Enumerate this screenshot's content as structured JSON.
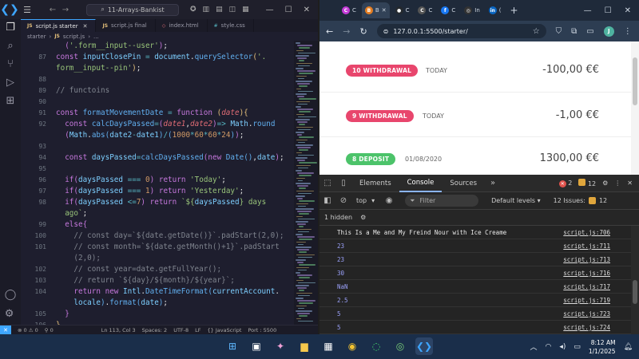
{
  "vscode": {
    "search_label": "11-Arrays-Bankist",
    "tabs": [
      {
        "label": "script.js starter",
        "type": "js",
        "active": true
      },
      {
        "label": "script.js final",
        "type": "js",
        "active": false
      },
      {
        "label": "index.html",
        "type": "html",
        "active": false
      },
      {
        "label": "style.css",
        "type": "css",
        "active": false
      }
    ],
    "breadcrumb": [
      "starter",
      "script.js",
      "..."
    ],
    "code_lines": [
      {
        "ln": "",
        "html": "  <span class='br2'>(</span><span class='str'>'.form__input--user'</span><span class='br2'>)</span>;"
      },
      {
        "ln": "87",
        "html": "<span class='kw'>const</span> <span class='var'>inputClosePin</span> <span class='op'>=</span> <span class='var'>document</span>.<span class='fn'>querySelector</span><span class='br1'>(</span><span class='str'>'.</span>"
      },
      {
        "ln": "",
        "html": "<span class='str'>form__input--pin'</span><span class='br1'>)</span>;"
      },
      {
        "ln": "88",
        "html": ""
      },
      {
        "ln": "89",
        "html": "<span class='cm'>// functoins</span>"
      },
      {
        "ln": "90",
        "html": ""
      },
      {
        "ln": "91",
        "html": "<span class='kw'>const</span> <span class='fn'>formatMovementDate</span> <span class='op'>=</span> <span class='kw'>function</span> <span class='br1'>(</span><span class='par'>date</span><span class='br1'>){</span>"
      },
      {
        "ln": "92",
        "html": "  <span class='kw'>const</span> <span class='fn'>calcDaysPassed</span><span class='op'>=</span><span class='br2'>(</span><span class='par'>date1</span>,<span class='par'>date2</span><span class='br2'>)</span><span class='op'>=></span> <span class='var'>Math</span>.<span class='fn'>round</span>"
      },
      {
        "ln": "",
        "html": "  <span class='br2'>(</span><span class='var'>Math</span>.<span class='fn'>abs</span><span class='fn'>(</span><span class='var'>date2</span><span class='op'>-</span><span class='var'>date1</span><span class='fn'>)</span><span class='op'>/</span><span class='fn'>(</span><span class='num'>1000</span><span class='op'>*</span><span class='num'>60</span><span class='op'>*</span><span class='num'>60</span><span class='op'>*</span><span class='num'>24</span><span class='fn'>)</span><span class='br2'>)</span>;"
      },
      {
        "ln": "93",
        "html": ""
      },
      {
        "ln": "94",
        "html": "  <span class='kw'>const</span> <span class='var'>daysPassed</span><span class='op'>=</span><span class='fn'>calcDaysPassed</span><span class='br2'>(</span><span class='kw'>new</span> <span class='fn'>Date</span><span class='fn'>()</span>,<span class='var'>date</span><span class='br2'>)</span>;"
      },
      {
        "ln": "95",
        "html": ""
      },
      {
        "ln": "96",
        "html": "  <span class='kw'>if</span><span class='br2'>(</span><span class='var'>daysPassed</span> <span class='op'>===</span> <span class='num'>0</span><span class='br2'>)</span> <span class='kw'>return</span> <span class='str'>'Today'</span>;"
      },
      {
        "ln": "97",
        "html": "  <span class='kw'>if</span><span class='br2'>(</span><span class='var'>daysPassed</span> <span class='op'>===</span> <span class='num'>1</span><span class='br2'>)</span> <span class='kw'>return</span> <span class='str'>'Yesterday'</span>;"
      },
      {
        "ln": "98",
        "html": "  <span class='kw'>if</span><span class='br2'>(</span><span class='var'>daysPassed</span> <span class='op'><=</span><span class='num'>7</span><span class='br2'>)</span> <span class='kw'>return</span> <span class='str'>`${</span><span class='var'>daysPassed</span><span class='str'>} days</span>"
      },
      {
        "ln": "",
        "html": "  <span class='str'>ago`</span>;"
      },
      {
        "ln": "99",
        "html": "  <span class='kw'>else</span><span class='br2'>{</span>"
      },
      {
        "ln": "100",
        "html": "    <span class='cm'>// const day=`${date.getDate()}`.padStart(2,0);</span>"
      },
      {
        "ln": "101",
        "html": "    <span class='cm'>// const month=`${date.getMonth()+1}`.padStart</span>"
      },
      {
        "ln": "",
        "html": "    <span class='cm'>(2,0);</span>"
      },
      {
        "ln": "102",
        "html": "    <span class='cm'>// const year=date.getFullYear();</span>"
      },
      {
        "ln": "103",
        "html": "    <span class='cm'>// return `${day}/${month}/${year}`;</span>"
      },
      {
        "ln": "104",
        "html": "    <span class='kw'>return</span> <span class='kw'>new</span> <span class='var'>Intl</span>.<span class='fn'>DateTimeFormat</span><span class='fn'>(</span><span class='var'>currentAccount</span>."
      },
      {
        "ln": "",
        "html": "    <span class='var'>locale</span><span class='fn'>)</span>.<span class='fn'>format</span><span class='fn'>(</span><span class='var'>date</span><span class='fn'>)</span>;"
      },
      {
        "ln": "105",
        "html": "  <span class='br2'>}</span>"
      },
      {
        "ln": "106",
        "html": "<span class='br1'>}</span>"
      }
    ],
    "status": {
      "errors": "0",
      "warnings": "0",
      "position": "Ln 113, Col 3",
      "spaces": "Spaces: 2",
      "encoding": "UTF-8",
      "eol": "LF",
      "language": "{} JavaScript",
      "port": "Port : 5500"
    }
  },
  "browser": {
    "tabs": [
      {
        "label": "C",
        "fav": "C",
        "color": "#c43ad6",
        "active": false
      },
      {
        "label": "B",
        "fav": "B",
        "color": "#e67e22",
        "active": true
      },
      {
        "label": "C",
        "fav": "●",
        "color": "#24292e",
        "active": false
      },
      {
        "label": "C",
        "fav": "C",
        "color": "#555",
        "active": false
      },
      {
        "label": "C",
        "fav": "f",
        "color": "#1877f2",
        "active": false
      },
      {
        "label": "In",
        "fav": "◎",
        "color": "#333",
        "active": false
      },
      {
        "label": "(",
        "fav": "in",
        "color": "#0a66c2",
        "active": false
      }
    ],
    "url": "127.0.0.1:5500/starter/",
    "avatar_letter": "J",
    "movements": [
      {
        "badge": "10 WITHDRAWAL",
        "type": "withdrawal",
        "date": "TODAY",
        "value": "-100,00 €€"
      },
      {
        "badge": "9 WITHDRAWAL",
        "type": "withdrawal",
        "date": "TODAY",
        "value": "-1,00 €€"
      },
      {
        "badge": "8 DEPOSIT",
        "type": "deposit",
        "date": "01/08/2020",
        "value": "1300,00 €€"
      }
    ],
    "colors": {
      "withdrawal": "#e8466d",
      "deposit": "#4cc36a"
    },
    "devtools": {
      "tabs": [
        "Elements",
        "Console",
        "Sources"
      ],
      "active_tab": "Console",
      "error_count": "2",
      "warning_count": "12",
      "context": "top",
      "filter_placeholder": "Filter",
      "levels": "Default levels",
      "issues_label": "12 Issues:",
      "issues_count": "12",
      "hidden_label": "1 hidden",
      "logs": [
        {
          "msg": "This Is a Me and My Freind Nour with Ice Creame",
          "kind": "text",
          "src": "script.js:706"
        },
        {
          "msg": "23",
          "kind": "num",
          "src": "script.js:711"
        },
        {
          "msg": "23",
          "kind": "num",
          "src": "script.js:713"
        },
        {
          "msg": "30",
          "kind": "num",
          "src": "script.js:716"
        },
        {
          "msg": "NaN",
          "kind": "num",
          "src": "script.js:717"
        },
        {
          "msg": "2.5",
          "kind": "num",
          "src": "script.js:719"
        },
        {
          "msg": "5",
          "kind": "num",
          "src": "script.js:723"
        },
        {
          "msg": "5",
          "kind": "num",
          "src": "script.js:724"
        }
      ]
    }
  },
  "taskbar": {
    "time": "8:12 AM",
    "date": "1/1/2025"
  }
}
